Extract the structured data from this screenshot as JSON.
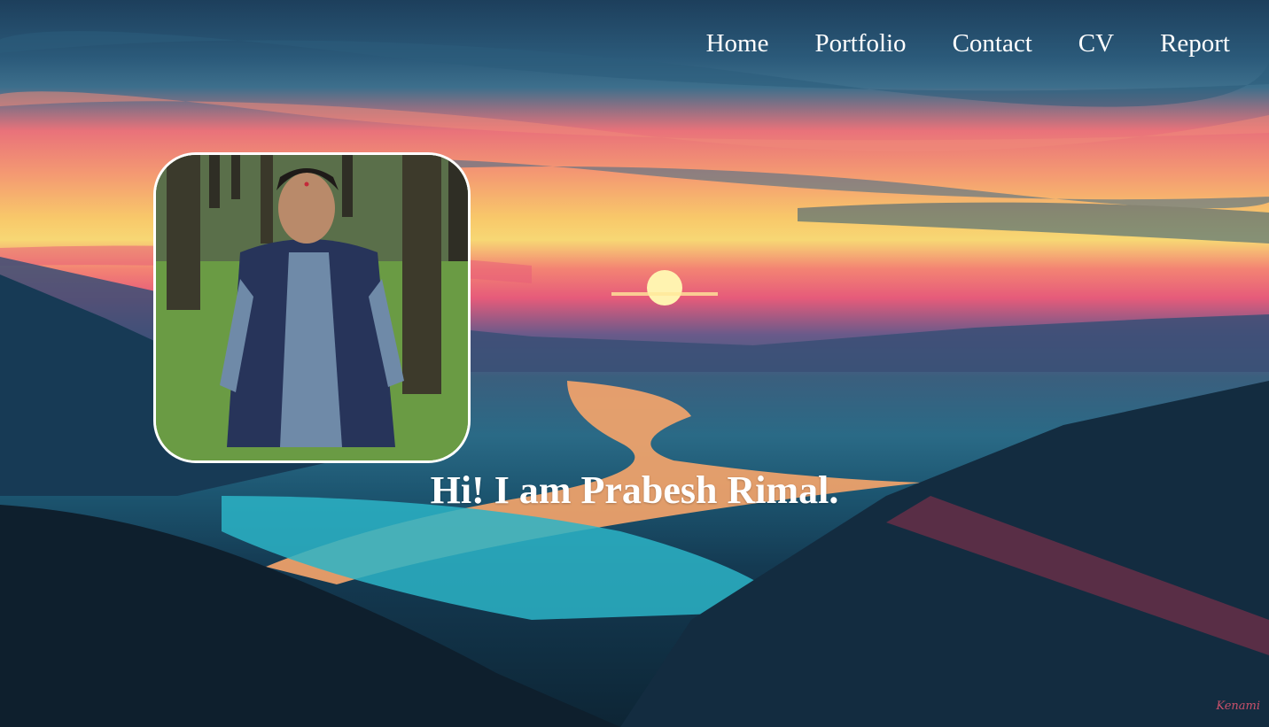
{
  "nav": {
    "items": [
      {
        "label": "Home"
      },
      {
        "label": "Portfolio"
      },
      {
        "label": "Contact"
      },
      {
        "label": "CV"
      },
      {
        "label": "Report"
      }
    ]
  },
  "hero": {
    "title": "Hi! I am Prabesh Rimal."
  },
  "background": {
    "signature": "Kenami"
  },
  "colors": {
    "nav_text": "#ffffff",
    "title_text": "#ffffff",
    "photo_border": "#ffffff"
  }
}
